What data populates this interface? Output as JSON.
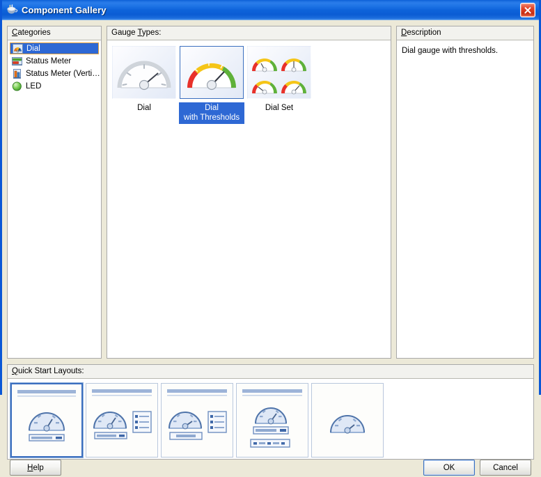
{
  "window": {
    "title": "Component Gallery",
    "icon": "java-coffee-cup-icon",
    "close_label": "Close"
  },
  "categories": {
    "header": "Categories",
    "header_mnemonic": "C",
    "items": [
      {
        "label": "Dial",
        "icon": "dial-gauge-icon",
        "selected": true
      },
      {
        "label": "Status Meter",
        "icon": "status-meter-horizontal-icon",
        "selected": false
      },
      {
        "label": "Status Meter (Verti…",
        "icon": "status-meter-vertical-icon",
        "selected": false
      },
      {
        "label": "LED",
        "icon": "led-icon",
        "selected": false
      }
    ]
  },
  "gauge_types": {
    "header": "Gauge Types:",
    "header_mnemonic": "T",
    "items": [
      {
        "label": "Dial",
        "icon": "dial-plain-thumbnail",
        "selected": false
      },
      {
        "label": "Dial\nwith Thresholds",
        "label_line1": "Dial",
        "label_line2": "with Thresholds",
        "icon": "dial-thresholds-thumbnail",
        "selected": true
      },
      {
        "label": "Dial Set",
        "icon": "dial-set-thumbnail",
        "selected": false
      }
    ]
  },
  "description": {
    "header": "Description",
    "header_mnemonic": "D",
    "text": "Dial gauge with thresholds."
  },
  "quick_start_layouts": {
    "header": "Quick Start Layouts:",
    "header_mnemonic": "Q",
    "items": [
      {
        "name": "layout-title-gauge-bar",
        "selected": true
      },
      {
        "name": "layout-title-gauge-bar-legend",
        "selected": false
      },
      {
        "name": "layout-title-gauge-smallbar-legend",
        "selected": false
      },
      {
        "name": "layout-title-gauge-two-bars",
        "selected": false
      },
      {
        "name": "layout-gauge-only",
        "selected": false
      }
    ]
  },
  "buttons": {
    "help": "Help",
    "help_mnemonic": "H",
    "ok": "OK",
    "cancel": "Cancel"
  },
  "colors": {
    "titlebar_blue": "#0b5fd8",
    "selection_blue": "#2e68d4",
    "selection_outline_orange": "#e8a33d",
    "focus_border_blue": "#3b6fbf",
    "dialog_face": "#ece9d8",
    "gauge_red": "#e8312a",
    "gauge_yellow": "#f5c518",
    "gauge_green": "#5fb13a",
    "close_red": "#c62d12"
  }
}
